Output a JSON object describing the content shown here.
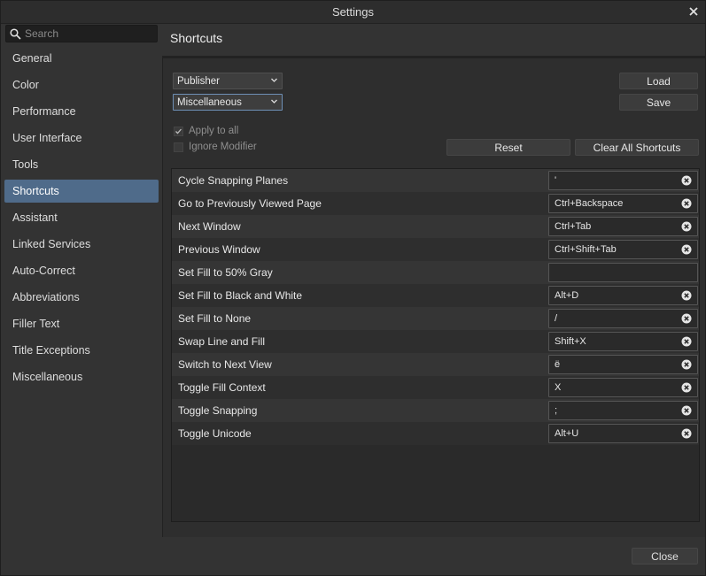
{
  "window": {
    "title": "Settings"
  },
  "sidebar": {
    "search_placeholder": "Search",
    "items": [
      {
        "label": "General"
      },
      {
        "label": "Color"
      },
      {
        "label": "Performance"
      },
      {
        "label": "User Interface"
      },
      {
        "label": "Tools"
      },
      {
        "label": "Shortcuts",
        "active": true
      },
      {
        "label": "Assistant"
      },
      {
        "label": "Linked Services"
      },
      {
        "label": "Auto-Correct"
      },
      {
        "label": "Abbreviations"
      },
      {
        "label": "Filler Text"
      },
      {
        "label": "Title Exceptions"
      },
      {
        "label": "Miscellaneous"
      }
    ]
  },
  "main": {
    "heading": "Shortcuts",
    "app_select": "Publisher",
    "category_select": "Miscellaneous",
    "load_label": "Load",
    "save_label": "Save",
    "apply_to_all": {
      "label": "Apply to all",
      "checked": true
    },
    "ignore_modifier": {
      "label": "Ignore Modifier",
      "checked": false
    },
    "reset_label": "Reset",
    "clear_all_label": "Clear All Shortcuts",
    "shortcuts": [
      {
        "name": "Cycle Snapping Planes",
        "key": "'"
      },
      {
        "name": "Go to Previously Viewed Page",
        "key": "Ctrl+Backspace"
      },
      {
        "name": "Next Window",
        "key": "Ctrl+Tab"
      },
      {
        "name": "Previous Window",
        "key": "Ctrl+Shift+Tab"
      },
      {
        "name": "Set Fill to 50% Gray",
        "key": ""
      },
      {
        "name": "Set Fill to Black and White",
        "key": "Alt+D"
      },
      {
        "name": "Set Fill to None",
        "key": "/"
      },
      {
        "name": "Swap Line and Fill",
        "key": "Shift+X"
      },
      {
        "name": "Switch to Next View",
        "key": "ë"
      },
      {
        "name": "Toggle Fill Context",
        "key": "X"
      },
      {
        "name": "Toggle Snapping",
        "key": ";"
      },
      {
        "name": "Toggle Unicode",
        "key": "Alt+U"
      }
    ]
  },
  "footer": {
    "close_label": "Close"
  },
  "colors": {
    "accent": "#4f6b8a",
    "background": "#333333",
    "panel": "#2e2e2e"
  },
  "icons": {
    "search": "search-icon",
    "close": "close-icon",
    "chevron": "chevron-down-icon",
    "clear": "clear-shortcut-icon",
    "check": "checkmark-icon"
  }
}
